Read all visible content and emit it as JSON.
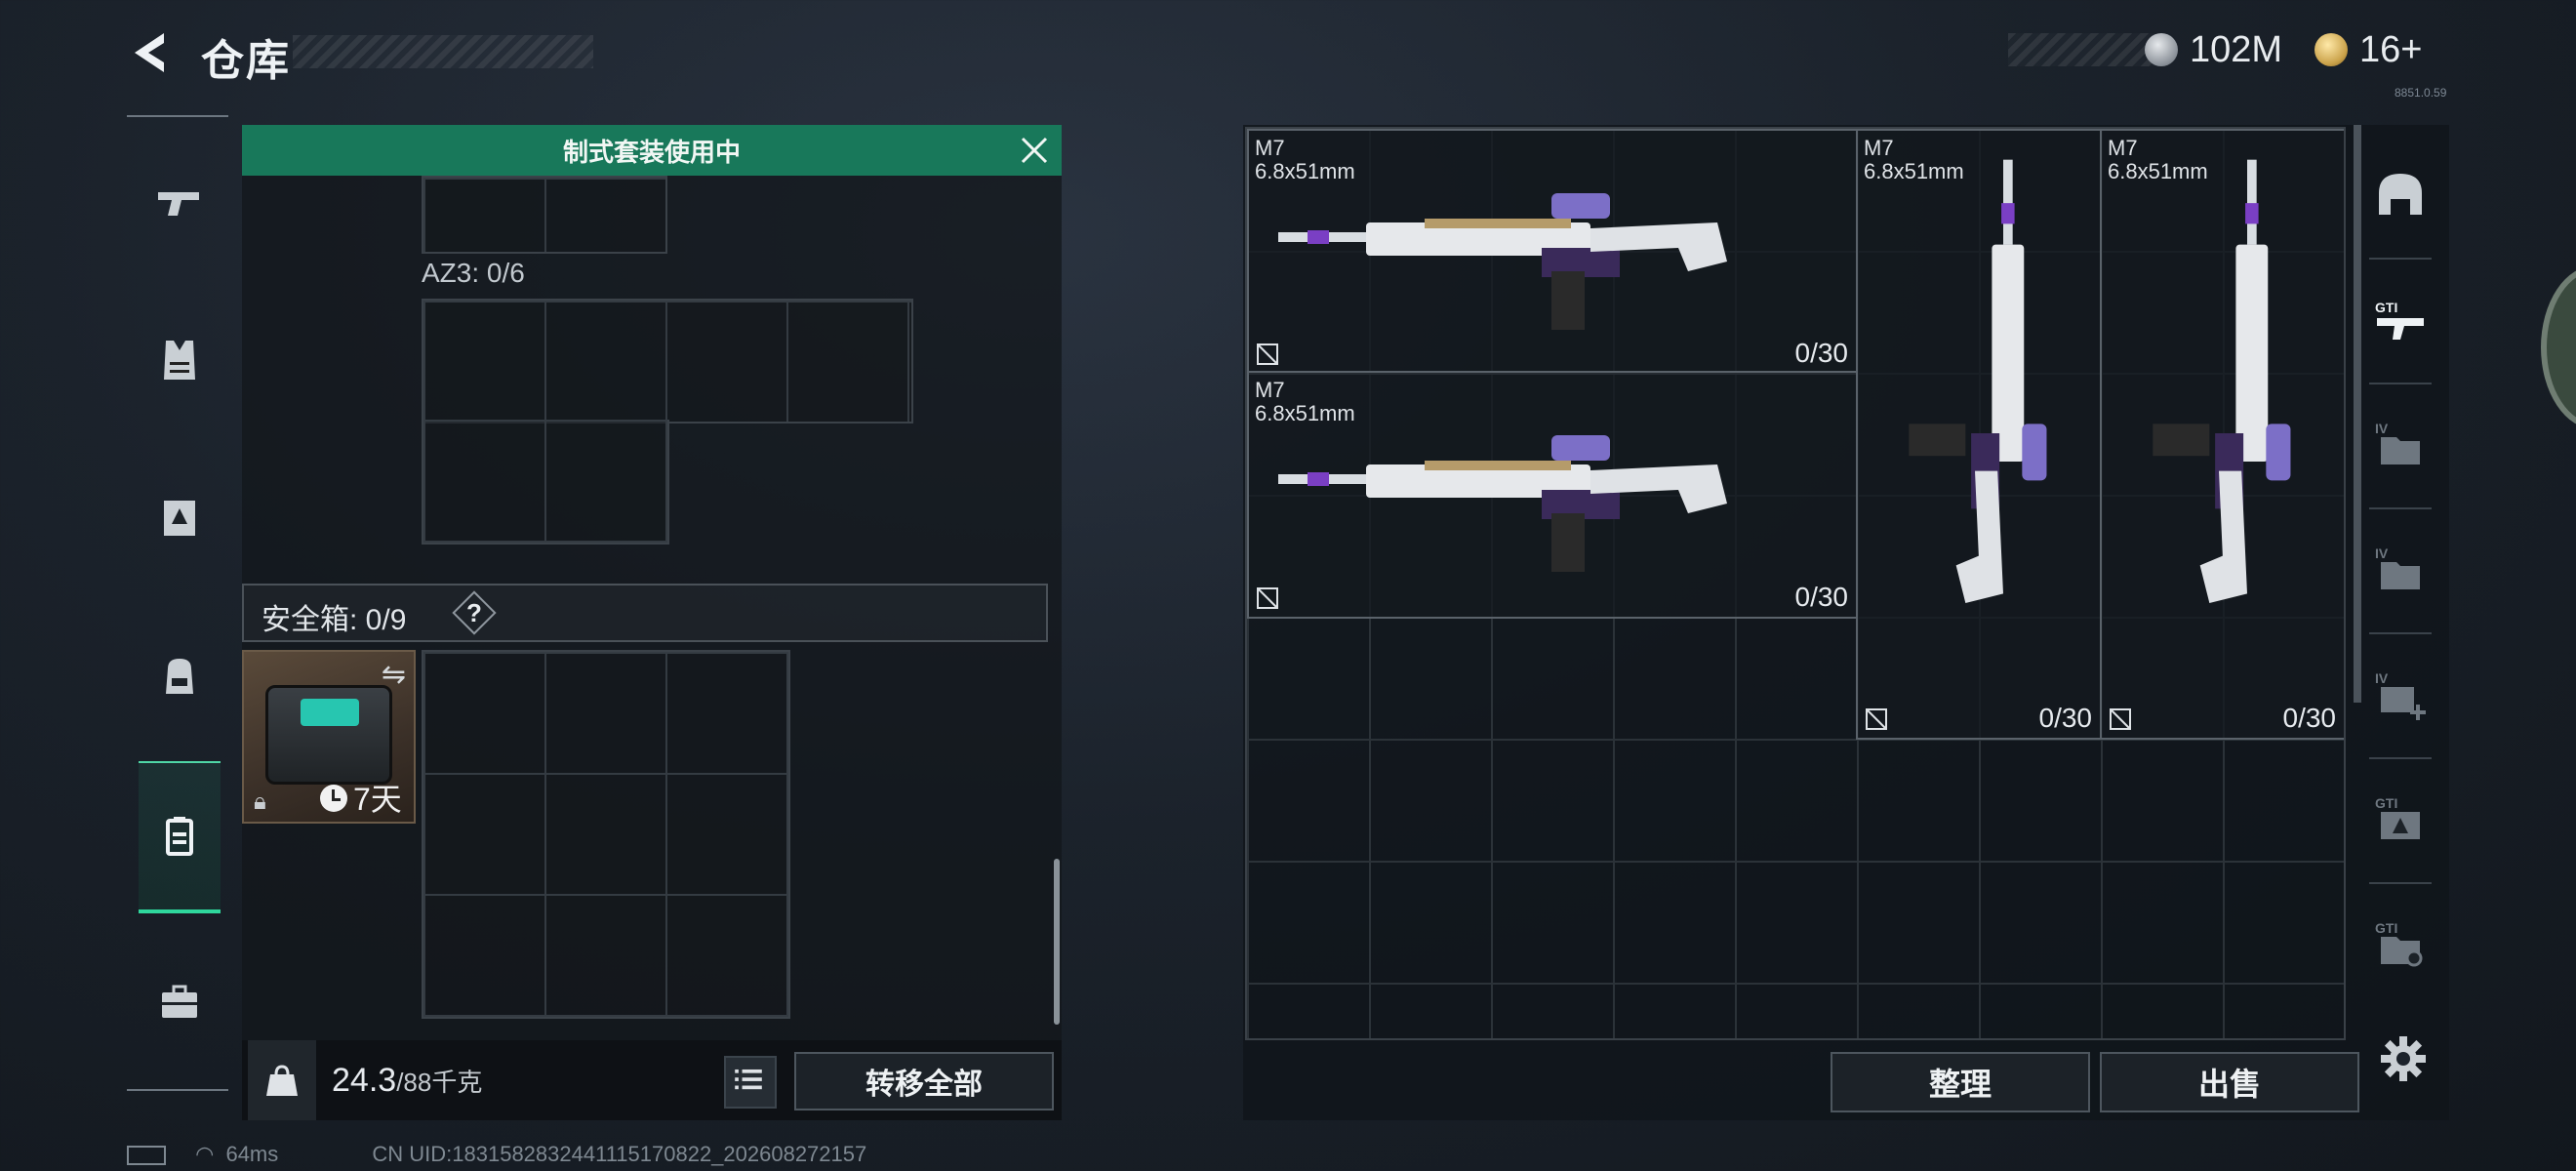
{
  "header": {
    "title": "仓库",
    "currency": [
      {
        "icon": "silver-coin-icon",
        "value": "102M"
      },
      {
        "icon": "gold-coin-icon",
        "value": "16+"
      }
    ],
    "small_version": "8851.0.59"
  },
  "left_tabs": [
    {
      "icon": "gun-icon",
      "active": false
    },
    {
      "icon": "vest-icon",
      "active": false
    },
    {
      "icon": "armor-icon",
      "active": false
    },
    {
      "icon": "backpack-icon",
      "active": false
    },
    {
      "icon": "safe-box-icon",
      "active": true
    },
    {
      "icon": "briefcase-icon",
      "active": false
    }
  ],
  "loadout": {
    "banner": "制式套装使用中",
    "az_label": "AZ3: 0/6",
    "safebox_label": "安全箱: 0/9",
    "help": "?",
    "safe_item_days": "7天",
    "weight_value": "24.3",
    "weight_max": "/88千克",
    "transfer_all": "转移全部"
  },
  "stash": {
    "weapons": [
      {
        "name": "M7\n6.8x51mm",
        "ammo": "0/30",
        "orientation": "horizontal"
      },
      {
        "name": "M7\n6.8x51mm",
        "ammo": "0/30",
        "orientation": "horizontal"
      },
      {
        "name": "M7\n6.8x51mm",
        "ammo": "0/30",
        "orientation": "vertical"
      },
      {
        "name": "M7\n6.8x51mm",
        "ammo": "0/30",
        "orientation": "vertical"
      }
    ],
    "sort_label": "整理",
    "sell_label": "出售"
  },
  "right_sidebar": [
    "helmet-icon",
    "gti-weapon-icon",
    "iv-folder-icon",
    "iv-folder-icon",
    "iv-add-icon",
    "gti-armor-icon",
    "gti-settings-icon"
  ],
  "status": {
    "ping": "64ms",
    "uid": "CN UID:1831582832441115170822_202608272157"
  },
  "colors": {
    "accent": "#18785a",
    "active_tab": "#2fd79d"
  }
}
